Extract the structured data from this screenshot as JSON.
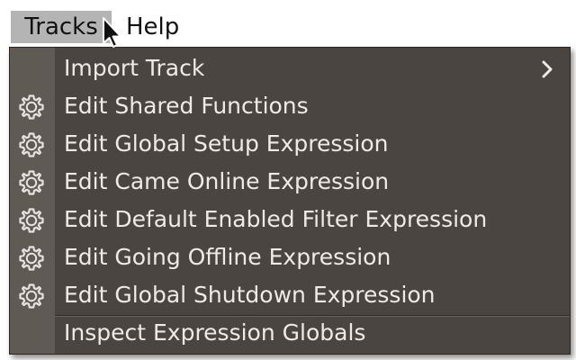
{
  "menubar": {
    "items": [
      {
        "label": "Tracks",
        "active": true
      },
      {
        "label": "Help",
        "active": false
      }
    ]
  },
  "menu": {
    "items": [
      {
        "label": "Import Track",
        "icon": "chevron-right-icon",
        "has_submenu": true
      },
      {
        "label": "Edit Shared Functions",
        "icon": "gear-icon"
      },
      {
        "label": "Edit Global Setup Expression",
        "icon": "gear-icon"
      },
      {
        "label": "Edit Came Online Expression",
        "icon": "gear-icon"
      },
      {
        "label": "Edit Default Enabled Filter Expression",
        "icon": "gear-icon"
      },
      {
        "label": "Edit Going Offline Expression",
        "icon": "gear-icon"
      },
      {
        "label": "Edit Global Shutdown Expression",
        "icon": "gear-icon"
      },
      {
        "label": "Inspect Expression Globals"
      }
    ]
  },
  "colors": {
    "menu_background": "#4a4540",
    "menu_gutter": "#605a54",
    "menu_text": "#eeebe6",
    "menubar_active": "#b4b4b4"
  }
}
